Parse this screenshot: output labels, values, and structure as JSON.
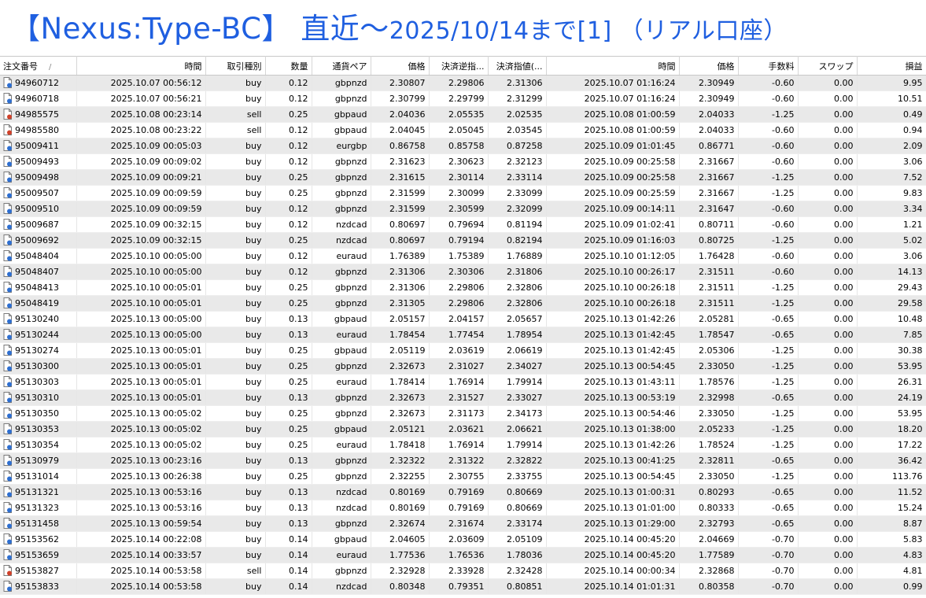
{
  "title": {
    "main": "【Nexus:Type-BC】 直近～",
    "date": "2025/10/14",
    "suffix": "まで[1] （リアル口座）"
  },
  "colors": {
    "title": "#1f5fe0",
    "buy_icon": "#2e6fd1",
    "sell_icon": "#d0412a"
  },
  "columns": [
    "注文番号",
    "時間",
    "取引種別",
    "数量",
    "通貨ペア",
    "価格",
    "決済逆指...",
    "決済指値(...",
    "時間",
    "価格",
    "手数料",
    "スワップ",
    "損益"
  ],
  "sort_indicator": "/",
  "rows": [
    [
      "94960712",
      "2025.10.07 00:56:12",
      "buy",
      "0.12",
      "gbpnzd",
      "2.30807",
      "2.29806",
      "2.31306",
      "2025.10.07 01:16:24",
      "2.30949",
      "-0.60",
      "0.00",
      "9.95"
    ],
    [
      "94960718",
      "2025.10.07 00:56:21",
      "buy",
      "0.12",
      "gbpnzd",
      "2.30799",
      "2.29799",
      "2.31299",
      "2025.10.07 01:16:24",
      "2.30949",
      "-0.60",
      "0.00",
      "10.51"
    ],
    [
      "94985575",
      "2025.10.08 00:23:14",
      "sell",
      "0.25",
      "gbpaud",
      "2.04036",
      "2.05535",
      "2.02535",
      "2025.10.08 01:00:59",
      "2.04033",
      "-1.25",
      "0.00",
      "0.49"
    ],
    [
      "94985580",
      "2025.10.08 00:23:22",
      "sell",
      "0.12",
      "gbpaud",
      "2.04045",
      "2.05045",
      "2.03545",
      "2025.10.08 01:00:59",
      "2.04033",
      "-0.60",
      "0.00",
      "0.94"
    ],
    [
      "95009411",
      "2025.10.09 00:05:03",
      "buy",
      "0.12",
      "eurgbp",
      "0.86758",
      "0.85758",
      "0.87258",
      "2025.10.09 01:01:45",
      "0.86771",
      "-0.60",
      "0.00",
      "2.09"
    ],
    [
      "95009493",
      "2025.10.09 00:09:02",
      "buy",
      "0.12",
      "gbpnzd",
      "2.31623",
      "2.30623",
      "2.32123",
      "2025.10.09 00:25:58",
      "2.31667",
      "-0.60",
      "0.00",
      "3.06"
    ],
    [
      "95009498",
      "2025.10.09 00:09:21",
      "buy",
      "0.25",
      "gbpnzd",
      "2.31615",
      "2.30114",
      "2.33114",
      "2025.10.09 00:25:58",
      "2.31667",
      "-1.25",
      "0.00",
      "7.52"
    ],
    [
      "95009507",
      "2025.10.09 00:09:59",
      "buy",
      "0.25",
      "gbpnzd",
      "2.31599",
      "2.30099",
      "2.33099",
      "2025.10.09 00:25:59",
      "2.31667",
      "-1.25",
      "0.00",
      "9.83"
    ],
    [
      "95009510",
      "2025.10.09 00:09:59",
      "buy",
      "0.12",
      "gbpnzd",
      "2.31599",
      "2.30599",
      "2.32099",
      "2025.10.09 00:14:11",
      "2.31647",
      "-0.60",
      "0.00",
      "3.34"
    ],
    [
      "95009687",
      "2025.10.09 00:32:15",
      "buy",
      "0.12",
      "nzdcad",
      "0.80697",
      "0.79694",
      "0.81194",
      "2025.10.09 01:02:41",
      "0.80711",
      "-0.60",
      "0.00",
      "1.21"
    ],
    [
      "95009692",
      "2025.10.09 00:32:15",
      "buy",
      "0.25",
      "nzdcad",
      "0.80697",
      "0.79194",
      "0.82194",
      "2025.10.09 01:16:03",
      "0.80725",
      "-1.25",
      "0.00",
      "5.02"
    ],
    [
      "95048404",
      "2025.10.10 00:05:00",
      "buy",
      "0.12",
      "euraud",
      "1.76389",
      "1.75389",
      "1.76889",
      "2025.10.10 01:12:05",
      "1.76428",
      "-0.60",
      "0.00",
      "3.06"
    ],
    [
      "95048407",
      "2025.10.10 00:05:00",
      "buy",
      "0.12",
      "gbpnzd",
      "2.31306",
      "2.30306",
      "2.31806",
      "2025.10.10 00:26:17",
      "2.31511",
      "-0.60",
      "0.00",
      "14.13"
    ],
    [
      "95048413",
      "2025.10.10 00:05:01",
      "buy",
      "0.25",
      "gbpnzd",
      "2.31306",
      "2.29806",
      "2.32806",
      "2025.10.10 00:26:18",
      "2.31511",
      "-1.25",
      "0.00",
      "29.43"
    ],
    [
      "95048419",
      "2025.10.10 00:05:01",
      "buy",
      "0.25",
      "gbpnzd",
      "2.31305",
      "2.29806",
      "2.32806",
      "2025.10.10 00:26:18",
      "2.31511",
      "-1.25",
      "0.00",
      "29.58"
    ],
    [
      "95130240",
      "2025.10.13 00:05:00",
      "buy",
      "0.13",
      "gbpaud",
      "2.05157",
      "2.04157",
      "2.05657",
      "2025.10.13 01:42:26",
      "2.05281",
      "-0.65",
      "0.00",
      "10.48"
    ],
    [
      "95130244",
      "2025.10.13 00:05:00",
      "buy",
      "0.13",
      "euraud",
      "1.78454",
      "1.77454",
      "1.78954",
      "2025.10.13 01:42:45",
      "1.78547",
      "-0.65",
      "0.00",
      "7.85"
    ],
    [
      "95130274",
      "2025.10.13 00:05:01",
      "buy",
      "0.25",
      "gbpaud",
      "2.05119",
      "2.03619",
      "2.06619",
      "2025.10.13 01:42:45",
      "2.05306",
      "-1.25",
      "0.00",
      "30.38"
    ],
    [
      "95130300",
      "2025.10.13 00:05:01",
      "buy",
      "0.25",
      "gbpnzd",
      "2.32673",
      "2.31027",
      "2.34027",
      "2025.10.13 00:54:45",
      "2.33050",
      "-1.25",
      "0.00",
      "53.95"
    ],
    [
      "95130303",
      "2025.10.13 00:05:01",
      "buy",
      "0.25",
      "euraud",
      "1.78414",
      "1.76914",
      "1.79914",
      "2025.10.13 01:43:11",
      "1.78576",
      "-1.25",
      "0.00",
      "26.31"
    ],
    [
      "95130310",
      "2025.10.13 00:05:01",
      "buy",
      "0.13",
      "gbpnzd",
      "2.32673",
      "2.31527",
      "2.33027",
      "2025.10.13 00:53:19",
      "2.32998",
      "-0.65",
      "0.00",
      "24.19"
    ],
    [
      "95130350",
      "2025.10.13 00:05:02",
      "buy",
      "0.25",
      "gbpnzd",
      "2.32673",
      "2.31173",
      "2.34173",
      "2025.10.13 00:54:46",
      "2.33050",
      "-1.25",
      "0.00",
      "53.95"
    ],
    [
      "95130353",
      "2025.10.13 00:05:02",
      "buy",
      "0.25",
      "gbpaud",
      "2.05121",
      "2.03621",
      "2.06621",
      "2025.10.13 01:38:00",
      "2.05233",
      "-1.25",
      "0.00",
      "18.20"
    ],
    [
      "95130354",
      "2025.10.13 00:05:02",
      "buy",
      "0.25",
      "euraud",
      "1.78418",
      "1.76914",
      "1.79914",
      "2025.10.13 01:42:26",
      "1.78524",
      "-1.25",
      "0.00",
      "17.22"
    ],
    [
      "95130979",
      "2025.10.13 00:23:16",
      "buy",
      "0.13",
      "gbpnzd",
      "2.32322",
      "2.31322",
      "2.32822",
      "2025.10.13 00:41:25",
      "2.32811",
      "-0.65",
      "0.00",
      "36.42"
    ],
    [
      "95131014",
      "2025.10.13 00:26:38",
      "buy",
      "0.25",
      "gbpnzd",
      "2.32255",
      "2.30755",
      "2.33755",
      "2025.10.13 00:54:45",
      "2.33050",
      "-1.25",
      "0.00",
      "113.76"
    ],
    [
      "95131321",
      "2025.10.13 00:53:16",
      "buy",
      "0.13",
      "nzdcad",
      "0.80169",
      "0.79169",
      "0.80669",
      "2025.10.13 01:00:31",
      "0.80293",
      "-0.65",
      "0.00",
      "11.52"
    ],
    [
      "95131323",
      "2025.10.13 00:53:16",
      "buy",
      "0.13",
      "nzdcad",
      "0.80169",
      "0.79169",
      "0.80669",
      "2025.10.13 01:01:00",
      "0.80333",
      "-0.65",
      "0.00",
      "15.24"
    ],
    [
      "95131458",
      "2025.10.13 00:59:54",
      "buy",
      "0.13",
      "gbpnzd",
      "2.32674",
      "2.31674",
      "2.33174",
      "2025.10.13 01:29:00",
      "2.32793",
      "-0.65",
      "0.00",
      "8.87"
    ],
    [
      "95153562",
      "2025.10.14 00:22:08",
      "buy",
      "0.14",
      "gbpaud",
      "2.04605",
      "2.03609",
      "2.05109",
      "2025.10.14 00:45:20",
      "2.04669",
      "-0.70",
      "0.00",
      "5.83"
    ],
    [
      "95153659",
      "2025.10.14 00:33:57",
      "buy",
      "0.14",
      "euraud",
      "1.77536",
      "1.76536",
      "1.78036",
      "2025.10.14 00:45:20",
      "1.77589",
      "-0.70",
      "0.00",
      "4.83"
    ],
    [
      "95153827",
      "2025.10.14 00:53:58",
      "sell",
      "0.14",
      "gbpnzd",
      "2.32928",
      "2.33928",
      "2.32428",
      "2025.10.14 00:00:34",
      "2.32868",
      "-0.70",
      "0.00",
      "4.81"
    ],
    [
      "95153833",
      "2025.10.14 00:53:58",
      "buy",
      "0.14",
      "nzdcad",
      "0.80348",
      "0.79351",
      "0.80851",
      "2025.10.14 01:01:31",
      "0.80358",
      "-0.70",
      "0.00",
      "0.99"
    ]
  ]
}
